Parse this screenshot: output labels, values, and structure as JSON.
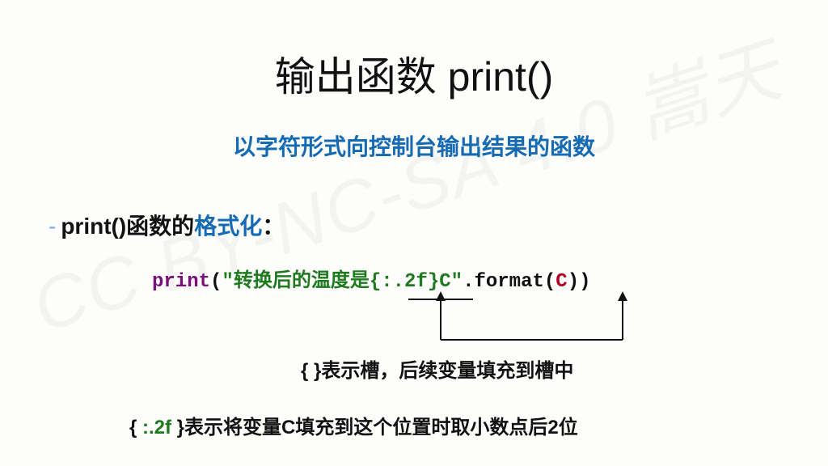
{
  "watermark": "CC BY-NC-SA 4.0 嵩天",
  "title": "输出函数 print()",
  "subtitle": "以字符形式向控制台输出结果的函数",
  "heading": {
    "dash": "-",
    "pre": "print()函数的",
    "fmt": "格式化",
    "colon": "："
  },
  "code": {
    "func": "print",
    "lp1": "(",
    "q1": "\"",
    "str_literal": "转换后的温度是",
    "slot_open": "{",
    "slot_body": ":.2f",
    "slot_close": "}",
    "str_tail": "C",
    "q2": "\"",
    "method": ".format",
    "lp2": "(",
    "arg": "C",
    "rp2": ")",
    "rp1": ")"
  },
  "note1": {
    "brace_l": "{ ",
    "brace_r": "}",
    "text": "表示槽，后续变量填充到槽中"
  },
  "note2": {
    "brace_l": "{ ",
    "token": ":.2f",
    "brace_r": " }",
    "text": "表示将变量C填充到这个位置时取小数点后2位"
  }
}
